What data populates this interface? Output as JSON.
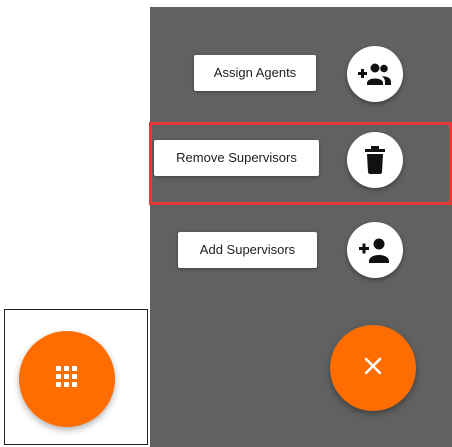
{
  "speed_dial": {
    "actions": [
      {
        "label": "Assign Agents",
        "icon": "group-add-icon"
      },
      {
        "label": "Remove Supervisors",
        "icon": "trash-icon"
      },
      {
        "label": "Add Supervisors",
        "icon": "person-add-icon"
      }
    ],
    "close_icon": "close-icon",
    "highlighted_action": "Remove Supervisors"
  },
  "collapsed_fab": {
    "icon": "apps-grid-icon"
  },
  "colors": {
    "overlay": "#616161",
    "accent": "#ff6d00",
    "highlight": "#e53935",
    "label_bg": "#ffffff",
    "icon": "#111111"
  }
}
